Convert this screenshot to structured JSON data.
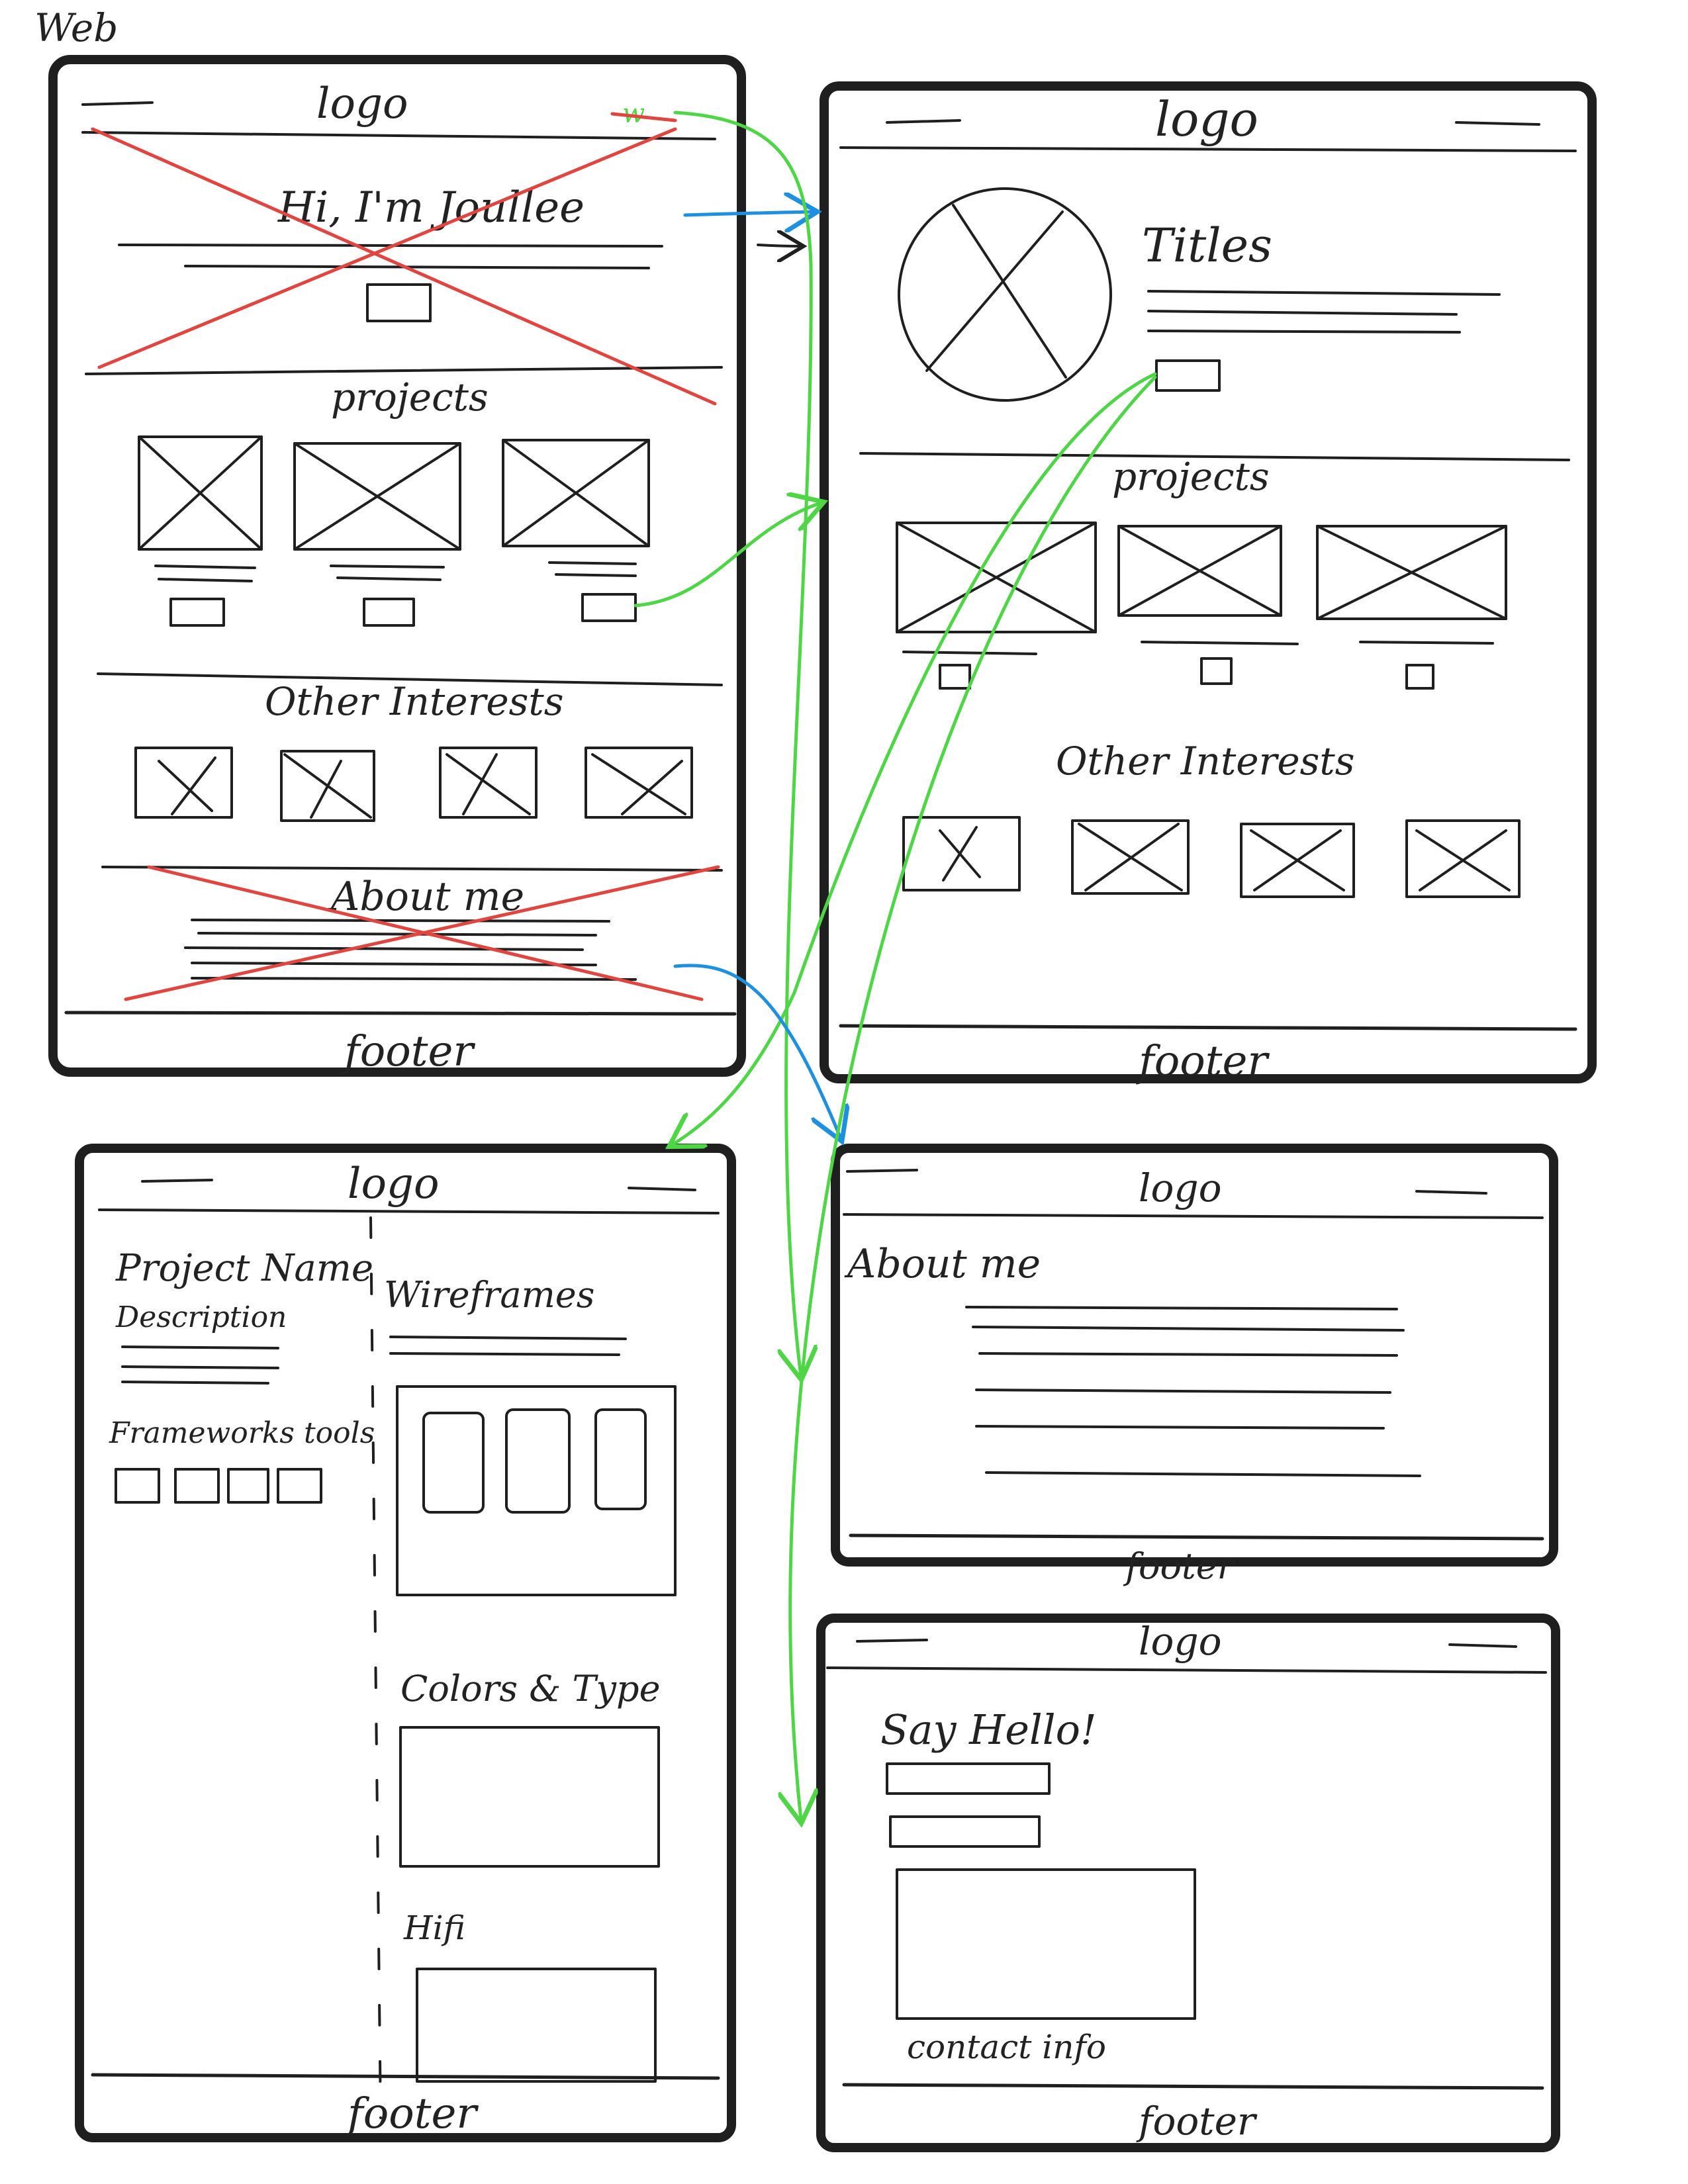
{
  "corner_label": "Web",
  "frame1": {
    "logo": "logo",
    "hero_heading": "Hi, I'm Joullee",
    "projects_heading": "projects",
    "interests_heading": "Other Interests",
    "about_heading": "About me",
    "footer": "footer"
  },
  "frame2": {
    "logo": "logo",
    "titles": "Titles",
    "projects_heading": "projects",
    "interests_heading": "Other Interests",
    "footer": "footer"
  },
  "frame3": {
    "logo": "logo",
    "project_name": "Project Name",
    "description": "Description",
    "frameworks_tools": "Frameworks tools",
    "wireframes": "Wireframes",
    "colors_type": "Colors & Type",
    "hifi": "Hifi",
    "footer": "footer"
  },
  "frame4": {
    "logo": "logo",
    "about_heading": "About me",
    "footer": "footer"
  },
  "frame5": {
    "logo": "logo",
    "say_hello": "Say Hello!",
    "contact_info": "contact info",
    "footer": "footer"
  },
  "colors": {
    "ink": "#1f1f1f",
    "strike_red": "#e0453f",
    "flow_green": "#4fd646",
    "flow_blue": "#1f8fe0"
  }
}
